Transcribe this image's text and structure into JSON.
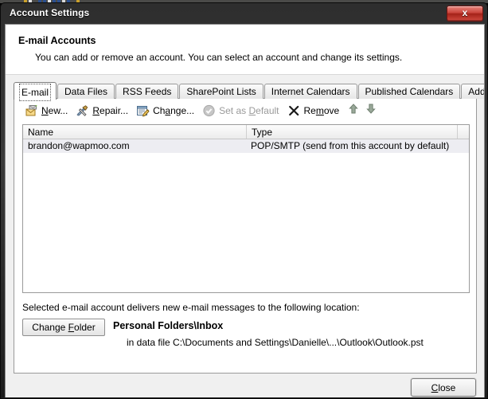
{
  "window": {
    "title": "Account Settings",
    "close_glyph": "x",
    "close_tooltip": "Close"
  },
  "header": {
    "title": "E-mail Accounts",
    "subtitle": "You can add or remove an account. You can select an account and change its settings."
  },
  "tabs": [
    {
      "label": "E-mail",
      "active": true
    },
    {
      "label": "Data Files",
      "active": false
    },
    {
      "label": "RSS Feeds",
      "active": false
    },
    {
      "label": "SharePoint Lists",
      "active": false
    },
    {
      "label": "Internet Calendars",
      "active": false
    },
    {
      "label": "Published Calendars",
      "active": false
    },
    {
      "label": "Address Books",
      "active": false
    }
  ],
  "toolbar": {
    "items": [
      {
        "label": "New...",
        "accel": "N",
        "icon": "new-mail-icon",
        "enabled": true
      },
      {
        "label": "Repair...",
        "accel": "R",
        "icon": "repair-tools-icon",
        "enabled": true
      },
      {
        "label": "Change...",
        "accel": "a",
        "icon": "change-edit-icon",
        "enabled": true
      },
      {
        "label": "Set as Default",
        "accel": "D",
        "icon": "check-circle-icon",
        "enabled": false
      },
      {
        "label": "Remove",
        "accel": "m",
        "icon": "remove-x-icon",
        "enabled": true
      }
    ],
    "move_up_icon": "arrow-up-icon",
    "move_down_icon": "arrow-down-icon"
  },
  "accounts_table": {
    "columns": [
      "Name",
      "Type"
    ],
    "rows": [
      {
        "name": "brandon@wapmoo.com",
        "type": "POP/SMTP (send from this account by default)",
        "selected": true
      }
    ]
  },
  "delivery": {
    "label": "Selected e-mail account delivers new e-mail messages to the following location:",
    "change_folder_button": "Change Folder",
    "change_folder_accel": "F",
    "folder_name": "Personal Folders\\Inbox",
    "folder_path": "in data file C:\\Documents and Settings\\Danielle\\...\\Outlook\\Outlook.pst"
  },
  "footer": {
    "close_button": "Close",
    "close_accel": "C"
  },
  "colors": {
    "titlebar_dark": "#2e2e2e",
    "close_red": "#c9443b",
    "dialog_face": "#f0f0f0",
    "selection_row": "#ededf2",
    "disabled_text": "#9a9a9a"
  }
}
